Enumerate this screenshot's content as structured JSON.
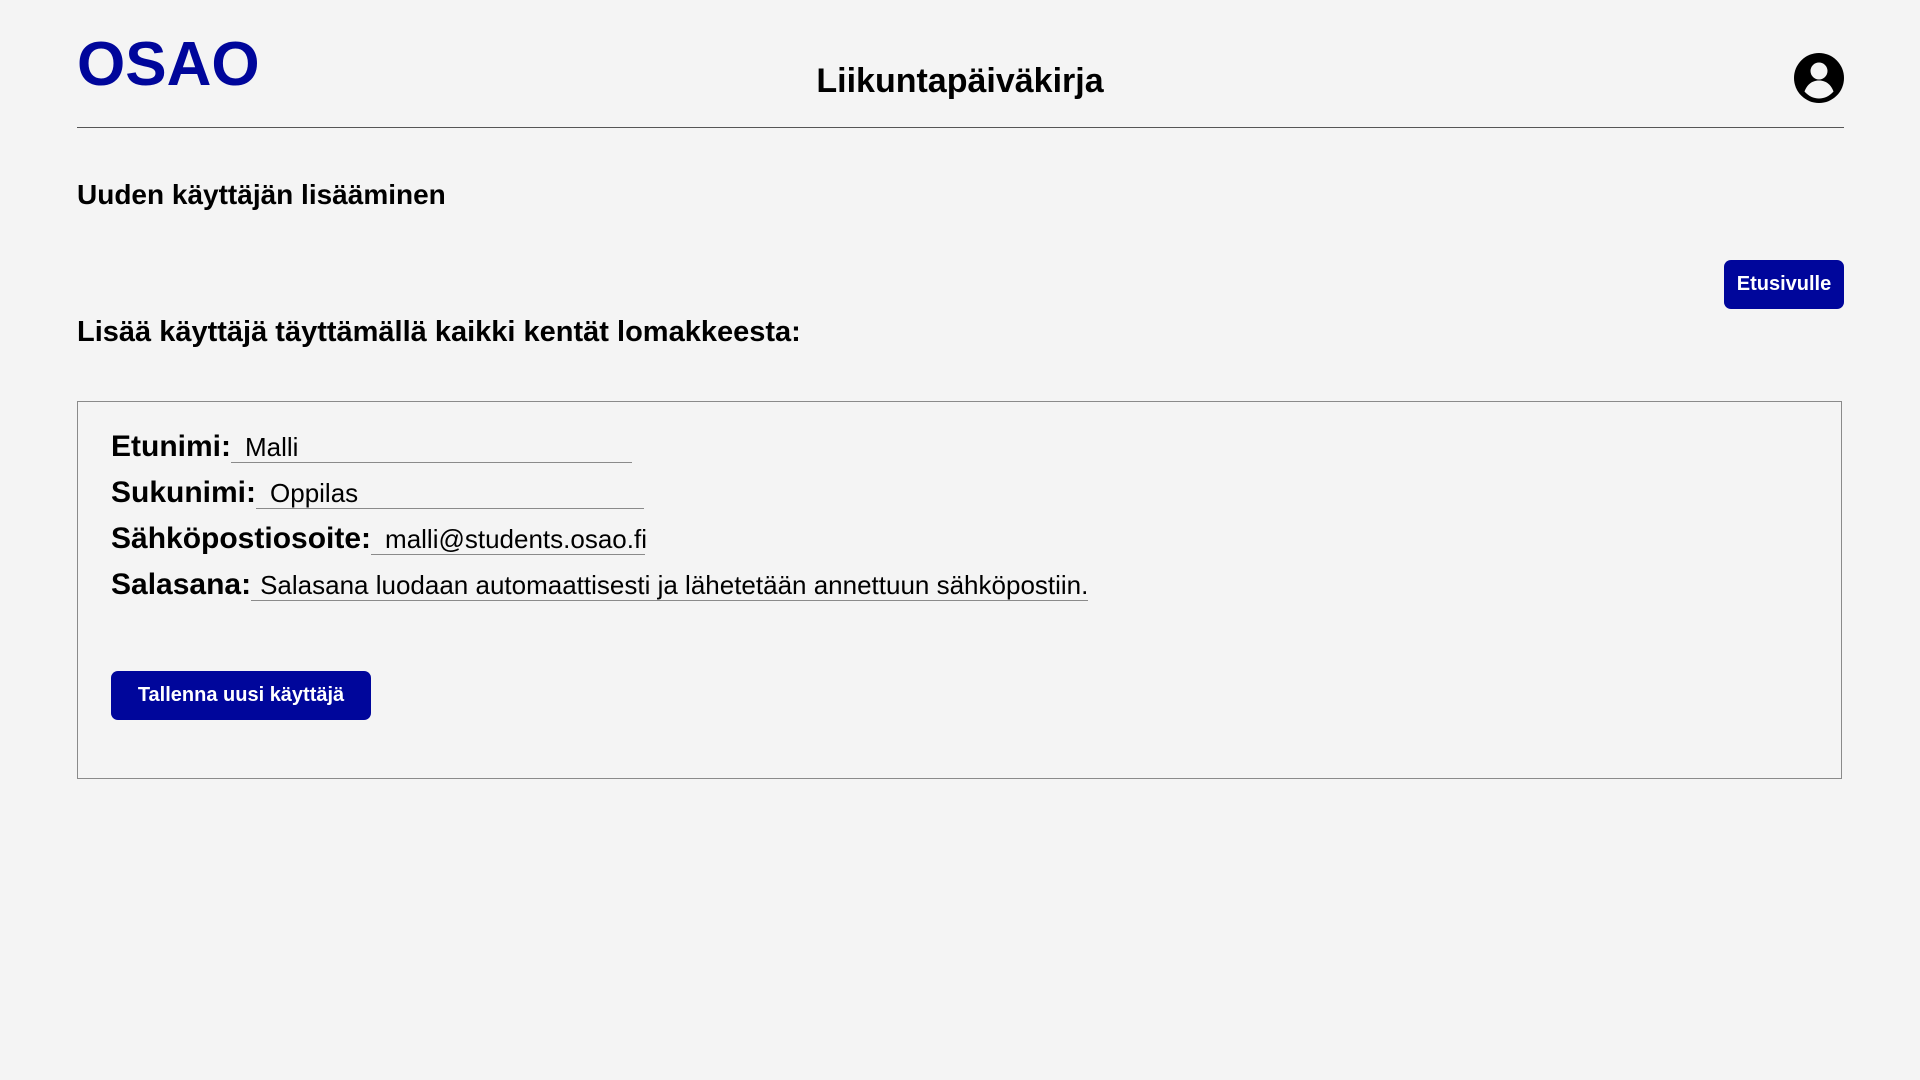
{
  "header": {
    "logo": "OSAO",
    "app_title": "Liikuntapäiväkirja",
    "user_icon": "account-circle-icon"
  },
  "main": {
    "section_title": "Uuden käyttäjän lisääminen",
    "home_button_label": "Etusivulle",
    "instruction": "Lisää käyttäjä täyttämällä kaikki kentät lomakkeesta:"
  },
  "form": {
    "fields": [
      {
        "label": "Etunimi:",
        "value": "Malli"
      },
      {
        "label": "Sukunimi:",
        "value": "Oppilas"
      },
      {
        "label": "Sähköpostiosoite:",
        "value": "malli@students.osao.fi"
      },
      {
        "label": "Salasana:",
        "value": "Salasana luodaan automaattisesti ja lähetetään annettuun sähköpostiin."
      }
    ],
    "save_button_label": "Tallenna uusi käyttäjä"
  },
  "colors": {
    "brand": "#00069b",
    "background": "#f4f4f4"
  }
}
